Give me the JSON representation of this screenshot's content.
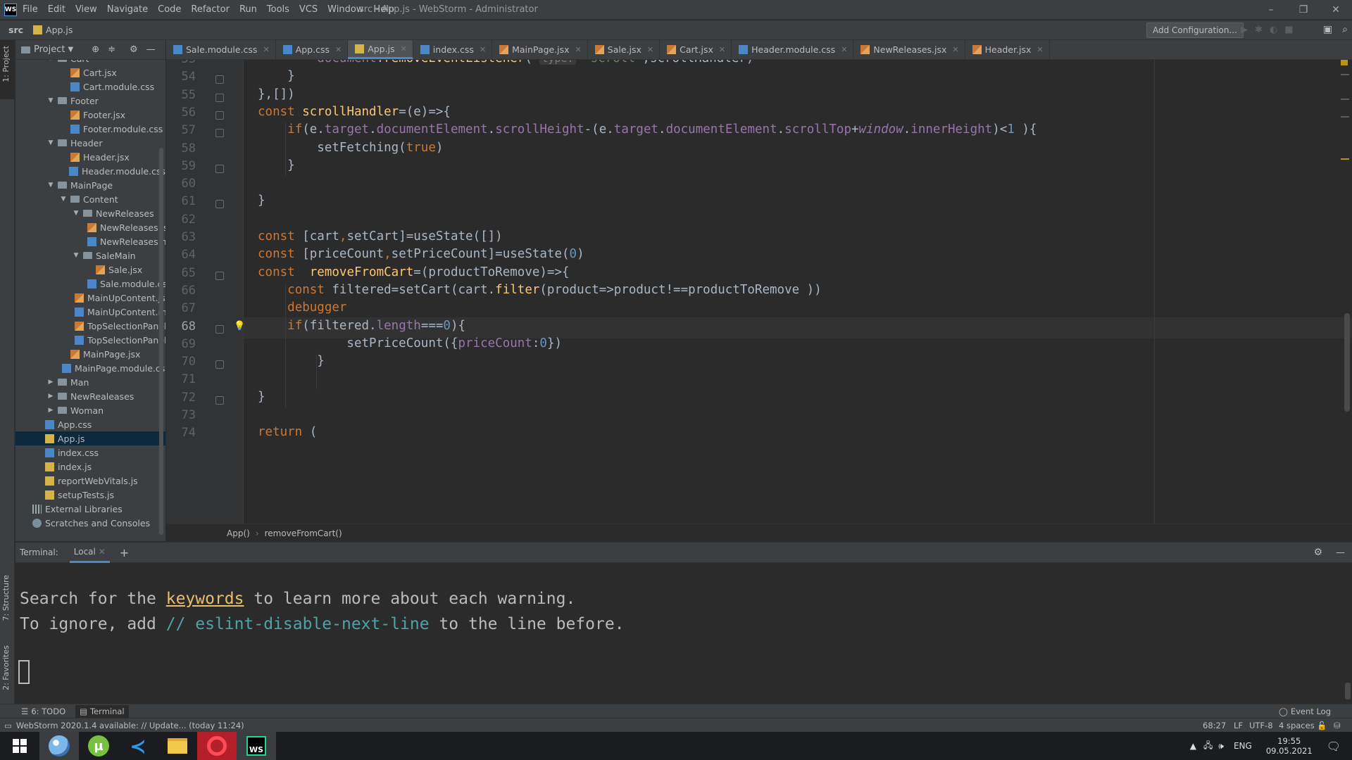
{
  "app": {
    "logo_text": "WS",
    "window_title": "src - App.js - WebStorm - Administrator"
  },
  "menu": [
    "File",
    "Edit",
    "View",
    "Navigate",
    "Code",
    "Refactor",
    "Run",
    "Tools",
    "VCS",
    "Window",
    "Help"
  ],
  "window_controls": {
    "minimize": "–",
    "maximize": "❐",
    "close": "✕"
  },
  "navbar": {
    "crumb_root": "src",
    "crumb_file": "App.js",
    "add_config": "Add Configuration..."
  },
  "project_panel": {
    "title": "Project"
  },
  "project_tree": [
    {
      "label": "Cart",
      "type": "folder",
      "depth": 2,
      "open": true
    },
    {
      "label": "Cart.jsx",
      "type": "jsx",
      "depth": 3
    },
    {
      "label": "Cart.module.css",
      "type": "css",
      "depth": 3
    },
    {
      "label": "Footer",
      "type": "folder",
      "depth": 2,
      "open": true
    },
    {
      "label": "Footer.jsx",
      "type": "jsx",
      "depth": 3
    },
    {
      "label": "Footer.module.css",
      "type": "css",
      "depth": 3
    },
    {
      "label": "Header",
      "type": "folder",
      "depth": 2,
      "open": true
    },
    {
      "label": "Header.jsx",
      "type": "jsx",
      "depth": 3
    },
    {
      "label": "Header.module.css",
      "type": "css",
      "depth": 3
    },
    {
      "label": "MainPage",
      "type": "folder",
      "depth": 2,
      "open": true
    },
    {
      "label": "Content",
      "type": "folder",
      "depth": 3,
      "open": true
    },
    {
      "label": "NewReleases",
      "type": "folder",
      "depth": 4,
      "open": true
    },
    {
      "label": "NewReleases.jsx",
      "type": "jsx",
      "depth": 5
    },
    {
      "label": "NewReleases.mo",
      "type": "css",
      "depth": 5
    },
    {
      "label": "SaleMain",
      "type": "folder",
      "depth": 4,
      "open": true
    },
    {
      "label": "Sale.jsx",
      "type": "jsx",
      "depth": 5
    },
    {
      "label": "Sale.module.css",
      "type": "css",
      "depth": 5
    },
    {
      "label": "MainUpContent.jsx",
      "type": "jsx",
      "depth": 4
    },
    {
      "label": "MainUpContent.mo",
      "type": "css",
      "depth": 4
    },
    {
      "label": "TopSelectionPanel.j",
      "type": "jsx",
      "depth": 4
    },
    {
      "label": "TopSelectionPanel.i",
      "type": "css",
      "depth": 4
    },
    {
      "label": "MainPage.jsx",
      "type": "jsx",
      "depth": 3
    },
    {
      "label": "MainPage.module.css",
      "type": "css",
      "depth": 3
    },
    {
      "label": "Man",
      "type": "folder",
      "depth": 2,
      "open": false
    },
    {
      "label": "NewRealeases",
      "type": "folder",
      "depth": 2,
      "open": false
    },
    {
      "label": "Woman",
      "type": "folder",
      "depth": 2,
      "open": false
    },
    {
      "label": "App.css",
      "type": "css",
      "depth": 1
    },
    {
      "label": "App.js",
      "type": "js",
      "depth": 1,
      "selected": true
    },
    {
      "label": "index.css",
      "type": "css",
      "depth": 1
    },
    {
      "label": "index.js",
      "type": "js",
      "depth": 1
    },
    {
      "label": "reportWebVitals.js",
      "type": "js",
      "depth": 1
    },
    {
      "label": "setupTests.js",
      "type": "js",
      "depth": 1
    },
    {
      "label": "External Libraries",
      "type": "lib",
      "depth": 0
    },
    {
      "label": "Scratches and Consoles",
      "type": "scr",
      "depth": 0
    }
  ],
  "tabs": [
    {
      "label": "Sale.module.css",
      "type": "css"
    },
    {
      "label": "App.css",
      "type": "css"
    },
    {
      "label": "App.js",
      "type": "js",
      "active": true
    },
    {
      "label": "index.css",
      "type": "css"
    },
    {
      "label": "MainPage.jsx",
      "type": "jsx"
    },
    {
      "label": "Sale.jsx",
      "type": "jsx"
    },
    {
      "label": "Cart.jsx",
      "type": "jsx"
    },
    {
      "label": "Header.module.css",
      "type": "css"
    },
    {
      "label": "NewReleases.jsx",
      "type": "jsx"
    },
    {
      "label": "Header.jsx",
      "type": "jsx"
    }
  ],
  "code": {
    "current_line": 68,
    "lines": [
      {
        "num": "53",
        "html": "        <span class='p'>document</span>.<span class='f'>removeEventListener</span>( <span class='hint'>type:</span> <span style='color:#6a8759'>'scroll'</span>,scrollHandler)"
      },
      {
        "num": "54",
        "html": "    }"
      },
      {
        "num": "55",
        "html": "},[])"
      },
      {
        "num": "56",
        "html": "<span class='k'>const</span> <span class='f'>scrollHandler</span>=(e)=>{"
      },
      {
        "num": "57",
        "html": "    <span class='k'>if</span>(e.<span class='p'>target</span>.<span class='p'>documentElement</span>.<span class='p'>scrollHeight</span>-(e.<span class='p'>target</span>.<span class='p'>documentElement</span>.<span class='p'>scrollTop</span>+<span class='it'>window</span>.<span class='p'>innerHeight</span>)&lt;<span class='n'>1</span> ){"
      },
      {
        "num": "58",
        "html": "        setFetching(<span class='k'>true</span>)"
      },
      {
        "num": "59",
        "html": "    }"
      },
      {
        "num": "60",
        "html": ""
      },
      {
        "num": "61",
        "html": "}"
      },
      {
        "num": "62",
        "html": ""
      },
      {
        "num": "63",
        "html": "<span class='k'>const</span> [cart<span class='k'>,</span>setCart]=useState([])"
      },
      {
        "num": "64",
        "html": "<span class='k'>const</span> [priceCount<span class='k'>,</span>setPriceCount]=useState(<span class='n'>0</span>)"
      },
      {
        "num": "65",
        "html": "<span class='k'>const</span>  <span class='f'>removeFromCart</span>=(productToRemove)=>{"
      },
      {
        "num": "66",
        "html": "    <span class='k'>const</span> filtered=setCart(cart.<span class='f'>filter</span>(product=>product!==productToRemove ))"
      },
      {
        "num": "67",
        "html": "    <span class='k'>debugger</span>"
      },
      {
        "num": "68",
        "html": "    <span class='k'>if</span>(filtered.<span class='p'>length</span>===<span class='n'>0</span>){"
      },
      {
        "num": "69",
        "html": "            setPriceCount({<span class='p'>priceCount</span>:<span class='n'>0</span>})"
      },
      {
        "num": "70",
        "html": "        }"
      },
      {
        "num": "71",
        "html": ""
      },
      {
        "num": "72",
        "html": "}"
      },
      {
        "num": "73",
        "html": ""
      },
      {
        "num": "74",
        "html": "<span class='k'>return</span> ("
      }
    ]
  },
  "editor_breadcrumb": [
    "App()",
    "removeFromCart()"
  ],
  "terminal": {
    "title": "Terminal:",
    "tab": "Local",
    "line1_pre": "Search for the ",
    "line1_link": "keywords",
    "line1_post": " to learn more about each warning.",
    "line2_pre": "To ignore, add ",
    "line2_comment": "// eslint-disable-next-line",
    "line2_post": " to the line before."
  },
  "side_labels": {
    "project": "1: Project",
    "structure": "7: Structure",
    "favorites": "2: Favorites"
  },
  "bottom_toolwindows": {
    "todo": "6: TODO",
    "terminal": "Terminal",
    "event_log": "Event Log"
  },
  "status": {
    "message": "WebStorm 2020.1.4 available: // Update... (today 11:24)",
    "position": "68:27",
    "line_sep": "LF",
    "encoding": "UTF-8",
    "indent": "4 spaces"
  },
  "taskbar": {
    "lang": "ENG",
    "time": "19:55",
    "date": "09.05.2021"
  }
}
